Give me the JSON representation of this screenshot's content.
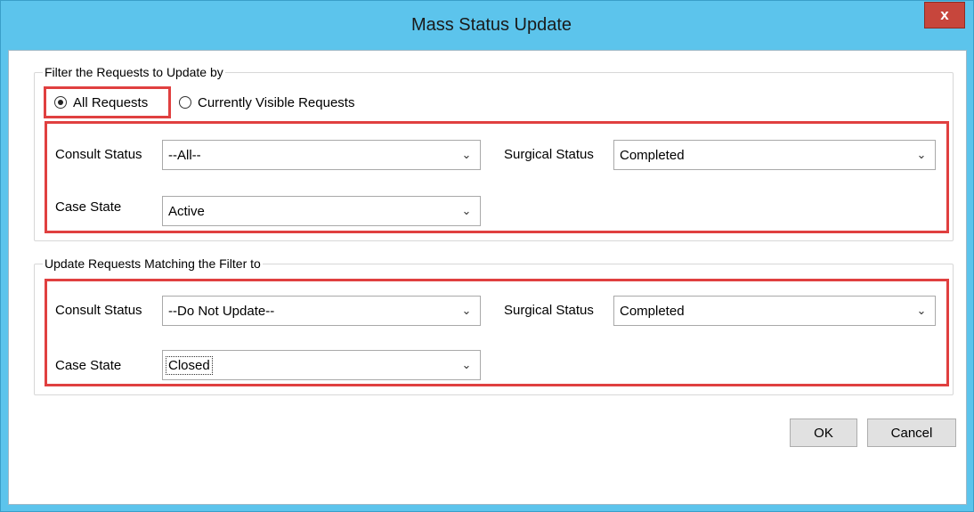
{
  "window": {
    "title": "Mass Status Update",
    "close_glyph": "x"
  },
  "filter_group": {
    "legend": "Filter the Requests to Update by",
    "radios": [
      {
        "label": "All Requests",
        "checked": true
      },
      {
        "label": "Currently Visible Requests",
        "checked": false
      }
    ],
    "consult_status": {
      "label": "Consult Status",
      "value": "--All--"
    },
    "surgical_status": {
      "label": "Surgical Status",
      "value": "Completed"
    },
    "case_state": {
      "label": "Case State",
      "value": "Active"
    }
  },
  "update_group": {
    "legend": "Update Requests Matching the Filter to",
    "consult_status": {
      "label": "Consult Status",
      "value": "--Do Not Update--"
    },
    "surgical_status": {
      "label": "Surgical Status",
      "value": "Completed"
    },
    "case_state": {
      "label": "Case State",
      "value": "Closed"
    }
  },
  "buttons": {
    "ok": "OK",
    "cancel": "Cancel"
  },
  "colors": {
    "titlebar": "#5cc4ec",
    "close": "#c7463c",
    "highlight": "#e04040"
  }
}
